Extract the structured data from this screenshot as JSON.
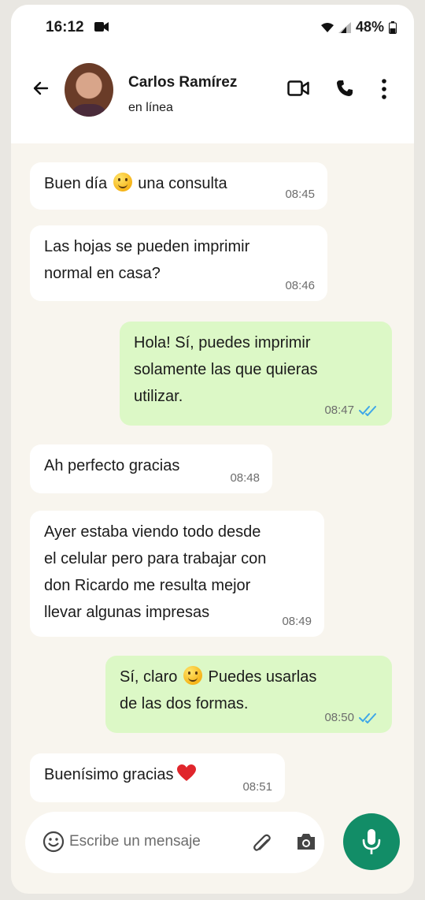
{
  "status_bar": {
    "time": "16:12",
    "battery": "48%"
  },
  "header": {
    "contact_name": "Carlos Ramírez",
    "status": "en línea"
  },
  "messages": [
    {
      "direction": "in",
      "lines": [
        "Buen día",
        "una consulta"
      ],
      "time": "08:45",
      "emoji": "smile"
    },
    {
      "direction": "in",
      "lines": [
        "Las hojas se pueden imprimir",
        "normal en casa?"
      ],
      "time": "08:46"
    },
    {
      "direction": "out",
      "lines": [
        "Hola! Sí, puedes imprimir",
        "solamente las que quieras",
        "utilizar."
      ],
      "time": "08:47",
      "read": true
    },
    {
      "direction": "in",
      "lines": [
        "Ah perfecto gracias"
      ],
      "time": "08:48"
    },
    {
      "direction": "in",
      "lines": [
        "Ayer estaba viendo todo desde",
        "el celular pero para trabajar con",
        "don Ricardo me resulta mejor",
        "llevar algunas impresas"
      ],
      "time": "08:49"
    },
    {
      "direction": "out",
      "lines": [
        "Sí, claro",
        "Puedes usarlas",
        "de las dos formas."
      ],
      "time": "08:50",
      "read": true,
      "emoji": "smile"
    },
    {
      "direction": "in",
      "lines": [
        "Buenísimo gracias"
      ],
      "time": "08:51",
      "emoji": "heart"
    }
  ],
  "composer": {
    "placeholder": "Escribe un mensaje"
  },
  "colors": {
    "incoming": "#ffffff",
    "outgoing": "#dcf8c6",
    "accent": "#128d67",
    "read_check": "#3ea6e8"
  },
  "icons": [
    "back-arrow-icon",
    "video-call-icon",
    "phone-icon",
    "more-options-icon",
    "emoji-icon",
    "attach-icon",
    "camera-icon",
    "mic-icon"
  ]
}
